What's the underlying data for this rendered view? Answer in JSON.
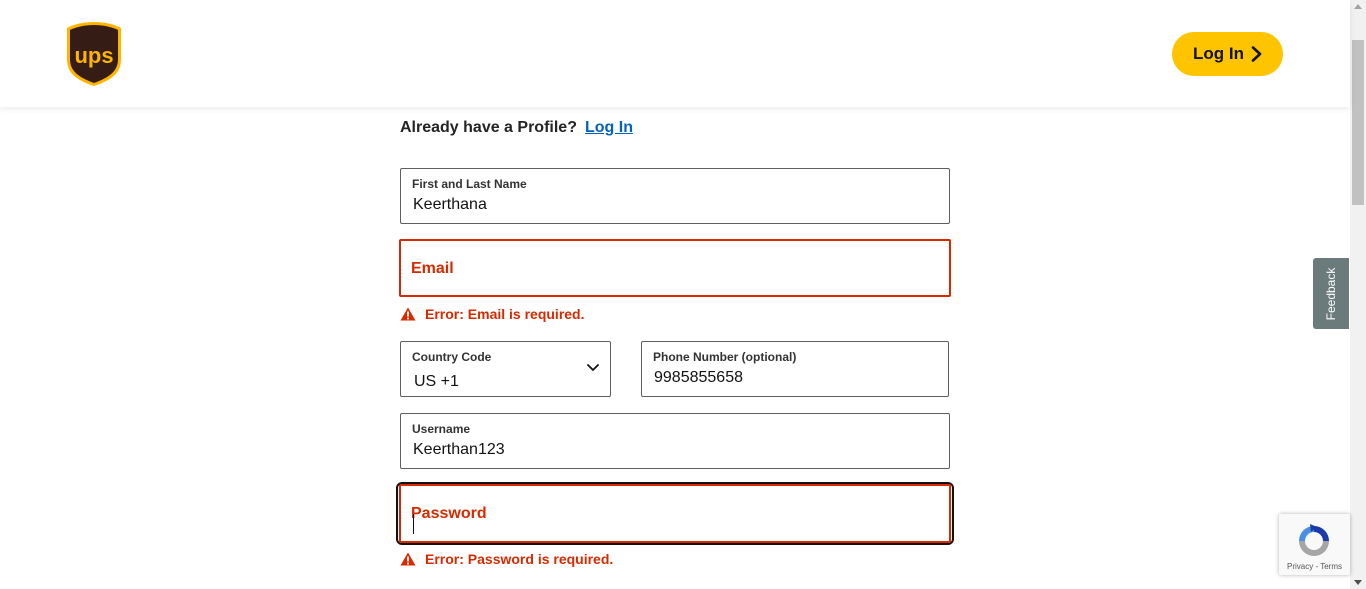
{
  "header": {
    "logo_text": "ups",
    "login_label": "Log In"
  },
  "profile_prompt": {
    "text": "Already have a Profile?",
    "link": "Log In"
  },
  "form": {
    "name": {
      "label": "First and Last Name",
      "value": "Keerthana"
    },
    "email": {
      "label": "Email",
      "value": "",
      "error": "Error: Email is required."
    },
    "country_code": {
      "label": "Country Code",
      "value": "US +1"
    },
    "phone": {
      "label": "Phone Number (optional)",
      "value": "9985855658"
    },
    "username": {
      "label": "Username",
      "value": "Keerthan123"
    },
    "password": {
      "label": "Password",
      "value": "",
      "error": "Error: Password is required."
    }
  },
  "feedback_tab": "Feedback",
  "recaptcha": {
    "privacy": "Privacy",
    "separator": " - ",
    "terms": "Terms"
  },
  "colors": {
    "brand_brown": "#351c15",
    "brand_gold": "#ffc400",
    "error_red": "#d82a00",
    "link_blue": "#0662bb"
  }
}
